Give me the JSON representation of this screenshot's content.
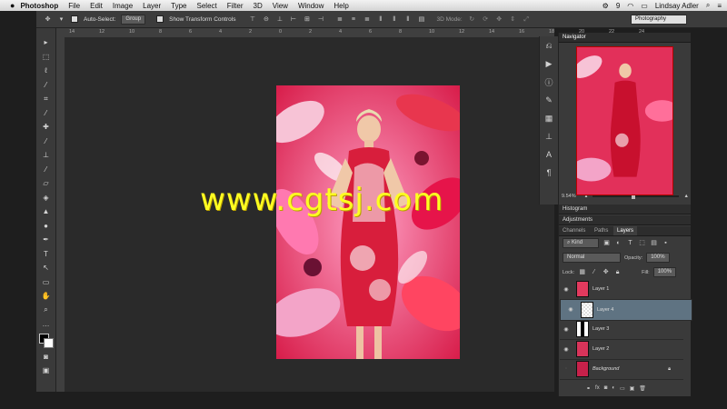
{
  "menubar": {
    "app": "Photoshop",
    "items": [
      "File",
      "Edit",
      "Image",
      "Layer",
      "Type",
      "Select",
      "Filter",
      "3D",
      "View",
      "Window",
      "Help"
    ],
    "user": "Lindsay Adler",
    "badge": "9"
  },
  "options": {
    "auto_select": "Auto-Select:",
    "group_value": "Group",
    "show_transform": "Show Transform Controls",
    "mode_3d": "3D Mode:",
    "workspace": "Photography"
  },
  "ruler": [
    "14",
    "12",
    "10",
    "8",
    "6",
    "4",
    "2",
    "0",
    "2",
    "4",
    "6",
    "8",
    "10",
    "12",
    "14",
    "16",
    "18",
    "20",
    "22",
    "24"
  ],
  "watermark": "www.cgtsj.com",
  "navigator": {
    "title": "Navigator",
    "zoom": "9.54%"
  },
  "histogram": {
    "title": "Histogram"
  },
  "adjustments": {
    "title": "Adjustments"
  },
  "layers_panel": {
    "tabs": [
      "Channels",
      "Paths",
      "Layers"
    ],
    "kind": "Kind",
    "blend": "Normal",
    "opacity_label": "Opacity:",
    "opacity": "100%",
    "lock_label": "Lock:",
    "fill_label": "Fill:",
    "fill": "100%",
    "layers": [
      {
        "name": "Layer 1",
        "selected": false
      },
      {
        "name": "Layer 4",
        "selected": true
      },
      {
        "name": "Layer 3",
        "selected": false
      },
      {
        "name": "Layer 2",
        "selected": false
      },
      {
        "name": "Background",
        "selected": false
      }
    ]
  },
  "colors": {
    "panel": "#3a3a3a",
    "selected_layer": "#5f7382",
    "watermark": "#ffff22"
  }
}
